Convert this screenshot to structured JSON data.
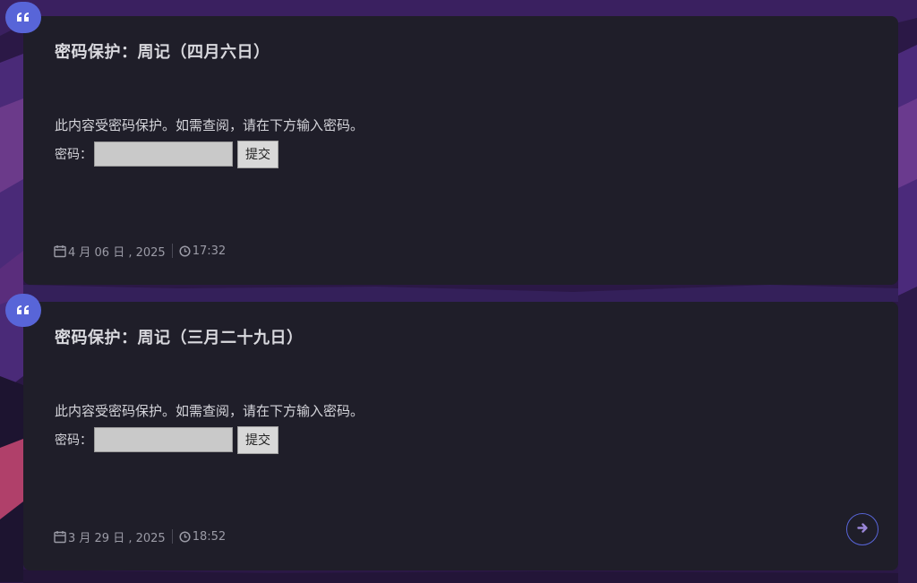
{
  "posts": [
    {
      "title": "密码保护：周记（四月六日）",
      "protected_message": "此内容受密码保护。如需查阅，请在下方输入密码。",
      "password_label": "密码：",
      "password_value": "",
      "submit_label": "提交",
      "date": "4 月 06 日 , 2025",
      "time": "17:32"
    },
    {
      "title": "密码保护：周记（三月二十九日）",
      "protected_message": "此内容受密码保护。如需查阅，请在下方输入密码。",
      "password_label": "密码：",
      "password_value": "",
      "submit_label": "提交",
      "date": "3 月 29 日 , 2025",
      "time": "18:52"
    }
  ],
  "icons": {
    "quote": "quote-icon",
    "calendar": "calendar-icon",
    "clock": "clock-icon",
    "next": "arrow-right-icon"
  },
  "colors": {
    "accent": "#5865d8",
    "card_bg": "#1f1e29",
    "page_bg": "#2a1744"
  }
}
